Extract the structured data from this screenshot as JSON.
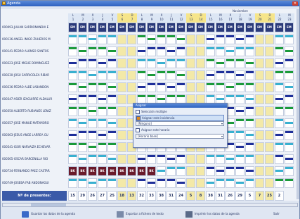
{
  "window": {
    "title": "Agenda"
  },
  "month_label": "Noviembre",
  "days": [
    {
      "l": "L",
      "n": "1"
    },
    {
      "l": "M",
      "n": "2"
    },
    {
      "l": "X",
      "n": "3"
    },
    {
      "l": "J",
      "n": "4"
    },
    {
      "l": "V",
      "n": "5"
    },
    {
      "l": "S",
      "n": "6"
    },
    {
      "l": "D",
      "n": "7"
    },
    {
      "l": "L",
      "n": "8"
    },
    {
      "l": "M",
      "n": "9"
    },
    {
      "l": "X",
      "n": "10"
    },
    {
      "l": "J",
      "n": "11"
    },
    {
      "l": "V",
      "n": "12"
    },
    {
      "l": "S",
      "n": "13"
    },
    {
      "l": "D",
      "n": "14"
    },
    {
      "l": "L",
      "n": "15"
    },
    {
      "l": "M",
      "n": "16"
    },
    {
      "l": "X",
      "n": "17"
    },
    {
      "l": "J",
      "n": "18"
    },
    {
      "l": "V",
      "n": "19"
    },
    {
      "l": "S",
      "n": "20"
    },
    {
      "l": "D",
      "n": "21"
    },
    {
      "l": "L",
      "n": "22"
    },
    {
      "l": "M",
      "n": "23"
    }
  ],
  "employees": [
    "000093-JULIAN SARRIONANDIA E",
    "000136-ANGEL INIGO ZUHEROS M",
    "000141-PEDRO ALONSO SANTOS",
    "000223-JOSE MIGUE DOMINGUEZ",
    "000230-JOSU SARRICOLEA RIBAR",
    "000236-PEDRO ALBE LABANDON",
    "000347-ASIER IZAGUIRRE ALDALUR",
    "000350-ALBERTO RUBIANES LENIZ",
    "000357-JOSE MANUE MATAMORO",
    "000363-JESUS ANGE LARREA GU",
    "000541-IGOR NARVAIZA ECHEVAR",
    "000565-OSCAR BARCENILLA RIO",
    "000734-FERNANDO PAEZ CASTAR",
    "000749-JOSEBA FAB ANDONAGUI"
  ],
  "row0_code": "EM",
  "row12_code": "BK",
  "footer": {
    "label": "Nº de presentes:",
    "values": [
      "15",
      "29",
      "26",
      "27",
      "25",
      "18",
      "13",
      "32",
      "33",
      "38",
      "31",
      "24",
      "5",
      "8",
      "38",
      "31",
      "26",
      "29",
      "5",
      "7",
      "25",
      "2"
    ]
  },
  "popup": {
    "title": "Asignar",
    "multi": "Selección múltiple",
    "incidencia": "Asignar este incidencia",
    "incidencia_value": "[Ninguna]",
    "horario": "Asignar este horario",
    "horario_value": "[Horario base]"
  },
  "toolbar": {
    "save": "Guardar los datos de la agenda",
    "export": "Exportar a fichero de texto",
    "print": "Imprimir los datos de la agenda",
    "exit": "Salir"
  },
  "colors": {
    "accent": "#2e62c0",
    "weekend": "#f3e9a8",
    "blue_bar": "#1e2f9a",
    "green_bar": "#1a9a3a",
    "cyan_bar": "#38b0d0"
  }
}
